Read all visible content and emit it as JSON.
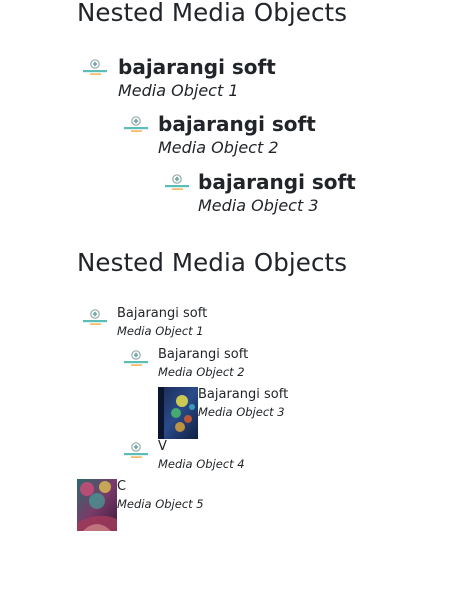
{
  "section1": {
    "heading": "Nested Media Objects",
    "items": [
      {
        "title": "bajarangi soft",
        "subtitle": "Media Object 1"
      },
      {
        "title": "bajarangi soft",
        "subtitle": "Media Object 2"
      },
      {
        "title": "bajarangi soft",
        "subtitle": "Media Object 3"
      }
    ]
  },
  "section2": {
    "heading": "Nested Media Objects",
    "items": [
      {
        "title": "Bajarangi soft",
        "subtitle": "Media Object 1",
        "thumb": "logo"
      },
      {
        "title": "Bajarangi soft",
        "subtitle": "Media Object 2",
        "thumb": "logo"
      },
      {
        "title": "Bajarangi soft",
        "subtitle": "Media Object 3",
        "thumb": "photo"
      },
      {
        "title": "V",
        "subtitle": "Media Object 4",
        "thumb": "logo"
      },
      {
        "title": "C",
        "subtitle": "Media Object 5",
        "thumb": "photo"
      }
    ]
  },
  "logo_lettering": "BAJARANGI SOFT",
  "colors": {
    "text": "#212529",
    "logo_teal": "#5bbdb8",
    "logo_orange": "#f39a2b"
  }
}
